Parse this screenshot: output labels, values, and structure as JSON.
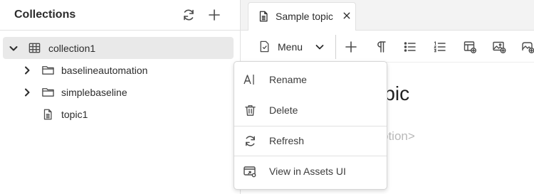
{
  "left_panel": {
    "title": "Collections",
    "refresh_icon": "refresh-icon",
    "add_icon": "plus-icon",
    "tree": [
      {
        "label": "collection1",
        "icon": "table-icon",
        "expanded": true,
        "selected": true
      },
      {
        "label": "baselineautomation",
        "icon": "folder-icon",
        "expanded": false
      },
      {
        "label": "simplebaseline",
        "icon": "folder-icon",
        "expanded": false
      },
      {
        "label": "topic1",
        "icon": "document-icon"
      }
    ]
  },
  "tab": {
    "label": "Sample topic",
    "icon": "document-icon",
    "close_icon": "close-icon"
  },
  "toolbar": {
    "menu_label": "Menu",
    "buttons": [
      "plus-icon",
      "paragraph-icon",
      "bullet-list-icon",
      "numbered-list-icon",
      "insert-table-icon",
      "insert-image-icon",
      "insert-media-icon"
    ]
  },
  "content": {
    "title_fragment": "topic",
    "placeholder_fragment": "otion>"
  },
  "dropdown": {
    "items": [
      {
        "label": "Rename",
        "icon": "rename-icon"
      },
      {
        "label": "Delete",
        "icon": "trash-icon"
      },
      {
        "label": "Refresh",
        "icon": "refresh-icon"
      },
      {
        "label": "View in Assets UI",
        "icon": "view-assets-icon"
      }
    ]
  },
  "colors": {
    "selected_row": "#e9e9e9",
    "tabbar": "#f3f3f3",
    "text": "#2c2c2c",
    "placeholder": "#b8b8b8"
  }
}
